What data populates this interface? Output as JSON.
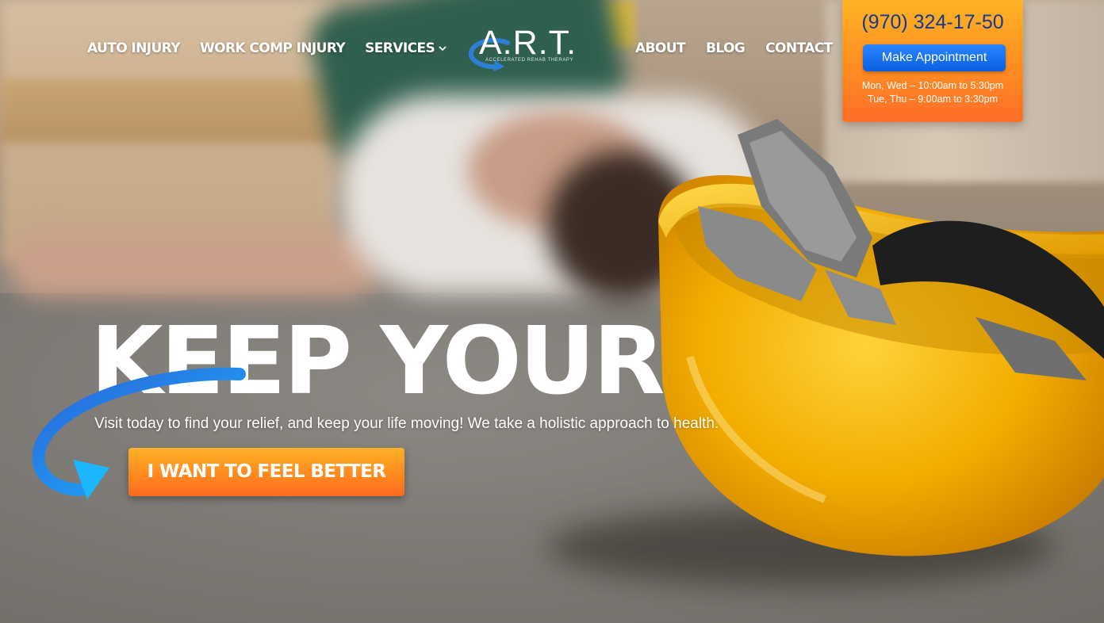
{
  "nav": {
    "left": [
      {
        "label": "AUTO INJURY"
      },
      {
        "label": "WORK COMP INJURY"
      },
      {
        "label": "SERVICES"
      }
    ],
    "right": [
      {
        "label": "ABOUT"
      },
      {
        "label": "BLOG"
      },
      {
        "label": "CONTACT"
      }
    ]
  },
  "logo": {
    "text": "A.R.T.",
    "tagline": "ACCELERATED REHAB THERAPY"
  },
  "appointment": {
    "phone": "(970) 324-17-50",
    "button": "Make Appointment",
    "hours_1": "Mon, Wed – 10:00am to 5:30pm",
    "hours_2": "Tue, Thu – 9:00am to 3:30pm"
  },
  "hero": {
    "headline": "KEEP YOUR LIFE MOVING",
    "tagline": "Visit today to find your relief, and keep your life moving! We take a holistic approach to health.",
    "cta": "I WANT TO FEEL BETTER"
  },
  "colors": {
    "accent_orange": "#ff8a1f",
    "button_blue": "#0a5fe0",
    "phone_blue": "#143a8c",
    "helmet_yellow": "#f2b200"
  },
  "icons": {
    "services_dropdown": "chevron-down-icon",
    "cta_pointer": "curved-arrow-icon"
  }
}
